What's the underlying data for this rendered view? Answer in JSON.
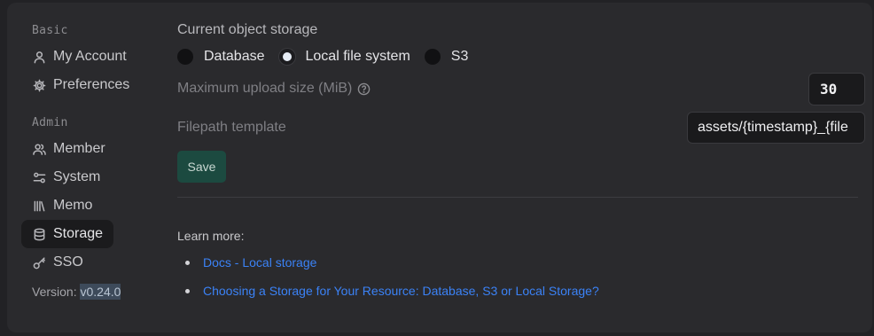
{
  "sidebar": {
    "basic_label": "Basic",
    "admin_label": "Admin",
    "items": [
      {
        "label": "My Account",
        "icon": "user-icon"
      },
      {
        "label": "Preferences",
        "icon": "gear-icon"
      },
      {
        "label": "Member",
        "icon": "users-icon"
      },
      {
        "label": "System",
        "icon": "settings-sliders-icon"
      },
      {
        "label": "Memo",
        "icon": "library-icon"
      },
      {
        "label": "Storage",
        "icon": "database-icon",
        "active": true
      },
      {
        "label": "SSO",
        "icon": "key-icon"
      }
    ],
    "version_label": "Version:",
    "version_value": "v0.24.0"
  },
  "main": {
    "heading": "Current object storage",
    "radios": [
      {
        "label": "Database",
        "checked": false
      },
      {
        "label": "Local file system",
        "checked": true
      },
      {
        "label": "S3",
        "checked": false
      }
    ],
    "max_upload_label": "Maximum upload size (MiB)",
    "max_upload_value": "30",
    "filepath_label": "Filepath template",
    "filepath_value": "assets/{timestamp}_{file",
    "save_label": "Save",
    "learn_more": "Learn more:",
    "links": [
      "Docs - Local storage",
      "Choosing a Storage for Your Resource: Database, S3 or Local Storage?"
    ]
  },
  "colors": {
    "accent_link": "#3b82f6",
    "save_button": "#1c4a40",
    "active_nav": "#1b1b1d"
  }
}
